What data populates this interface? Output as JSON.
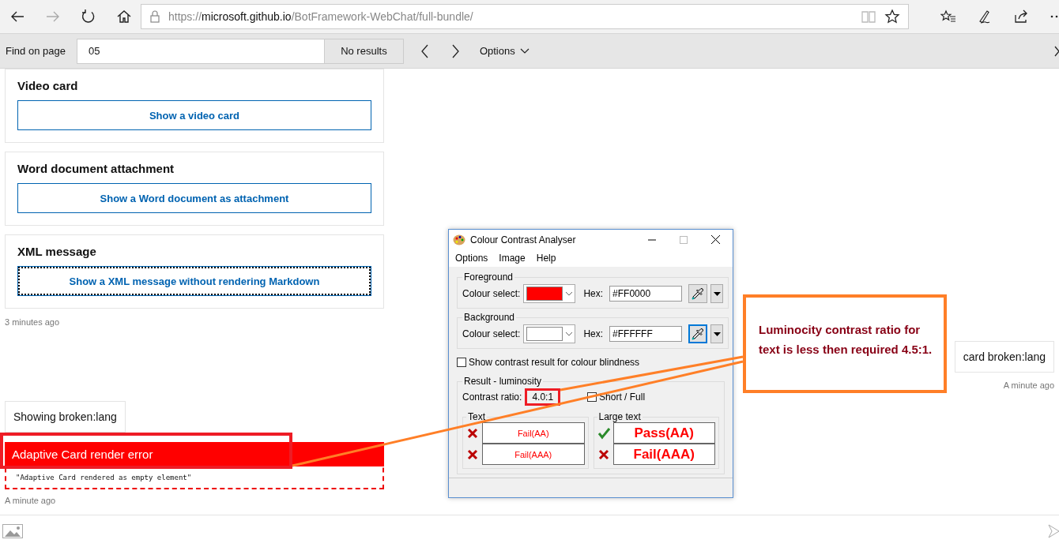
{
  "browser": {
    "nav": [
      {
        "kind": "back",
        "disabled": false
      },
      {
        "kind": "forward",
        "disabled": true
      },
      {
        "kind": "refresh",
        "disabled": false
      },
      {
        "kind": "home",
        "disabled": false
      }
    ],
    "url": {
      "scheme": "https://",
      "host": "microsoft.github.io",
      "path": "/BotFramework-WebChat/full-bundle/"
    },
    "address_icons": [
      {
        "kind": "reading-view"
      },
      {
        "kind": "favorite"
      }
    ],
    "tools": [
      {
        "kind": "favorites-list"
      },
      {
        "kind": "pen"
      },
      {
        "kind": "share"
      },
      {
        "kind": "more"
      }
    ]
  },
  "find_bar": {
    "label": "Find on page",
    "value": "05",
    "result": "No results",
    "options": "Options"
  },
  "chat": {
    "cards": [
      {
        "title": "Video card",
        "button": "Show a video card",
        "focused": false
      },
      {
        "title": "Word document attachment",
        "button": "Show a Word document as attachment",
        "focused": false
      },
      {
        "title": "XML message",
        "button": "Show a XML message without rendering Markdown",
        "focused": true
      }
    ],
    "cards_time": "3 minutes ago",
    "user_message": {
      "text": "card broken:lang",
      "time": "A minute ago"
    },
    "bot_message": {
      "text": "Showing broken:lang"
    },
    "error_card": {
      "title": "Adaptive Card render error",
      "body": "\"Adaptive Card rendered as empty element\"",
      "time": "A minute ago"
    }
  },
  "analyser": {
    "title": "Colour Contrast Analyser",
    "menu": [
      "Options",
      "Image",
      "Help"
    ],
    "colours": [
      {
        "legend": "Foreground",
        "label": "Colour select:",
        "color": "#ff0000",
        "hex_label": "Hex:",
        "hex": "#FF0000",
        "picker_active": false
      },
      {
        "legend": "Background",
        "label": "Colour select:",
        "color": "#ffffff",
        "hex_label": "Hex:",
        "hex": "#FFFFFF",
        "picker_active": true
      }
    ],
    "colour_blindness": {
      "label": "Show contrast result for colour blindness",
      "checked": false
    },
    "result": {
      "legend": "Result - luminosity",
      "ratio_label": "Contrast ratio:",
      "ratio": "4.0:1",
      "short_full": {
        "label": "Short / Full",
        "checked": false
      },
      "groups": [
        {
          "legend": "Text",
          "large": false,
          "rows": [
            {
              "pass": false,
              "label": "Fail(AA)"
            },
            {
              "pass": false,
              "label": "Fail(AAA)"
            }
          ]
        },
        {
          "legend": "Large text",
          "large": true,
          "rows": [
            {
              "pass": true,
              "label": "Pass(AA)"
            },
            {
              "pass": false,
              "label": "Fail(AAA)"
            }
          ]
        }
      ]
    }
  },
  "annotation": {
    "text": "Luminocity contrast ratio for text is less then required 4.5:1."
  }
}
